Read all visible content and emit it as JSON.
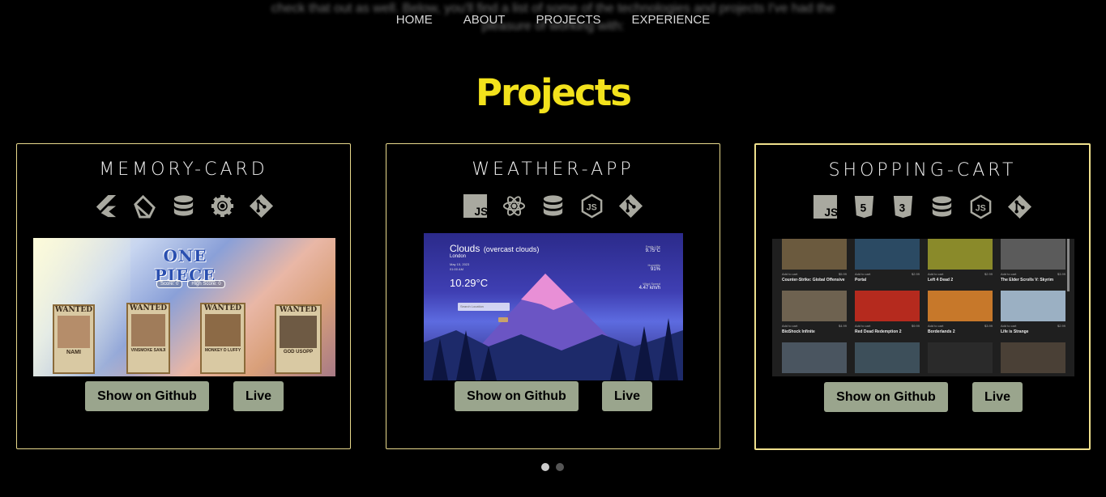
{
  "background_text": {
    "line1": "check that out as well. Below, you'll find a list of some of the technologies and projects I've had the",
    "line2": "pleasure of working with:"
  },
  "nav": {
    "items": [
      {
        "label": "HOME"
      },
      {
        "label": "ABOUT"
      },
      {
        "label": "PROJECTS"
      },
      {
        "label": "EXPERIENCE"
      }
    ]
  },
  "section": {
    "title": "Projects"
  },
  "projects": [
    {
      "title": "MEMORY-CARD",
      "tech_icons": [
        "flutter-icon",
        "pen-icon",
        "database-icon",
        "react-icon",
        "git-icon"
      ],
      "screenshot": {
        "logo_text": "ONE PIECE",
        "score_label": "Score: 0",
        "high_score_label": "High Score: 0",
        "cards": [
          "NAMI",
          "VINSMOKE SANJI",
          "MONKEY D LUFFY",
          "GOD USOPP"
        ],
        "wanted_label": "WANTED",
        "dead_or_alive": "DEAD OR ALIVE"
      },
      "github_label": "Show on Github",
      "live_label": "Live"
    },
    {
      "title": "WEATHER-APP",
      "tech_icons": [
        "javascript-icon",
        "react-icon",
        "database-icon",
        "nodejs-icon",
        "git-icon"
      ],
      "screenshot": {
        "condition": "Clouds",
        "detail": "(overcast clouds)",
        "city": "London",
        "date": "May 15, 2023",
        "time": "01:00 AM",
        "temperature": "10.29°C",
        "feels_like_label": "Feels Like",
        "feels_like_value": "9.75°C",
        "humidity_label": "Humidity",
        "humidity_value": "91%",
        "wind_label": "Wind Speed",
        "wind_value": "4.47 km/h",
        "search_placeholder": "Search Location"
      },
      "github_label": "Show on Github",
      "live_label": "Live"
    },
    {
      "title": "SHOPPING-CART",
      "tech_icons": [
        "javascript-icon",
        "html5-icon",
        "css3-icon",
        "database-icon",
        "nodejs-icon",
        "git-icon"
      ],
      "screenshot": {
        "add_label": "Add to cart",
        "games": [
          {
            "name": "Counter-Strike: Global Offensive",
            "price": "$5.99",
            "color": "#6b5a3e"
          },
          {
            "name": "Portal",
            "price": "$2.99",
            "color": "#2b4a63"
          },
          {
            "name": "Left 4 Dead 2",
            "price": "$2.99",
            "color": "#8a8a2a"
          },
          {
            "name": "The Elder Scrolls V: Skyrim",
            "price": "$3.99",
            "color": "#5b5b5b"
          },
          {
            "name": "BioShock Infinite",
            "price": "$4.99",
            "color": "#6e6250"
          },
          {
            "name": "Red Dead Redemption 2",
            "price": "$9.99",
            "color": "#b52a1e"
          },
          {
            "name": "Borderlands 2",
            "price": "$3.99",
            "color": "#c7782a"
          },
          {
            "name": "Life is Strange",
            "price": "$2.99",
            "color": "#9bb0c3"
          },
          {
            "name": "",
            "price": "",
            "color": "#4a5560"
          },
          {
            "name": "",
            "price": "",
            "color": "#3d4f5a"
          },
          {
            "name": "",
            "price": "",
            "color": "#2a2a2a"
          },
          {
            "name": "",
            "price": "",
            "color": "#4a4036"
          }
        ]
      },
      "github_label": "Show on Github",
      "live_label": "Live"
    }
  ],
  "carousel": {
    "pages": 2,
    "active": 0
  },
  "colors": {
    "background": "#000000",
    "title": "#f3e21c",
    "card_border": "#e8d98c",
    "button_bg": "#9aa58d",
    "icon": "#a9a9a0"
  }
}
